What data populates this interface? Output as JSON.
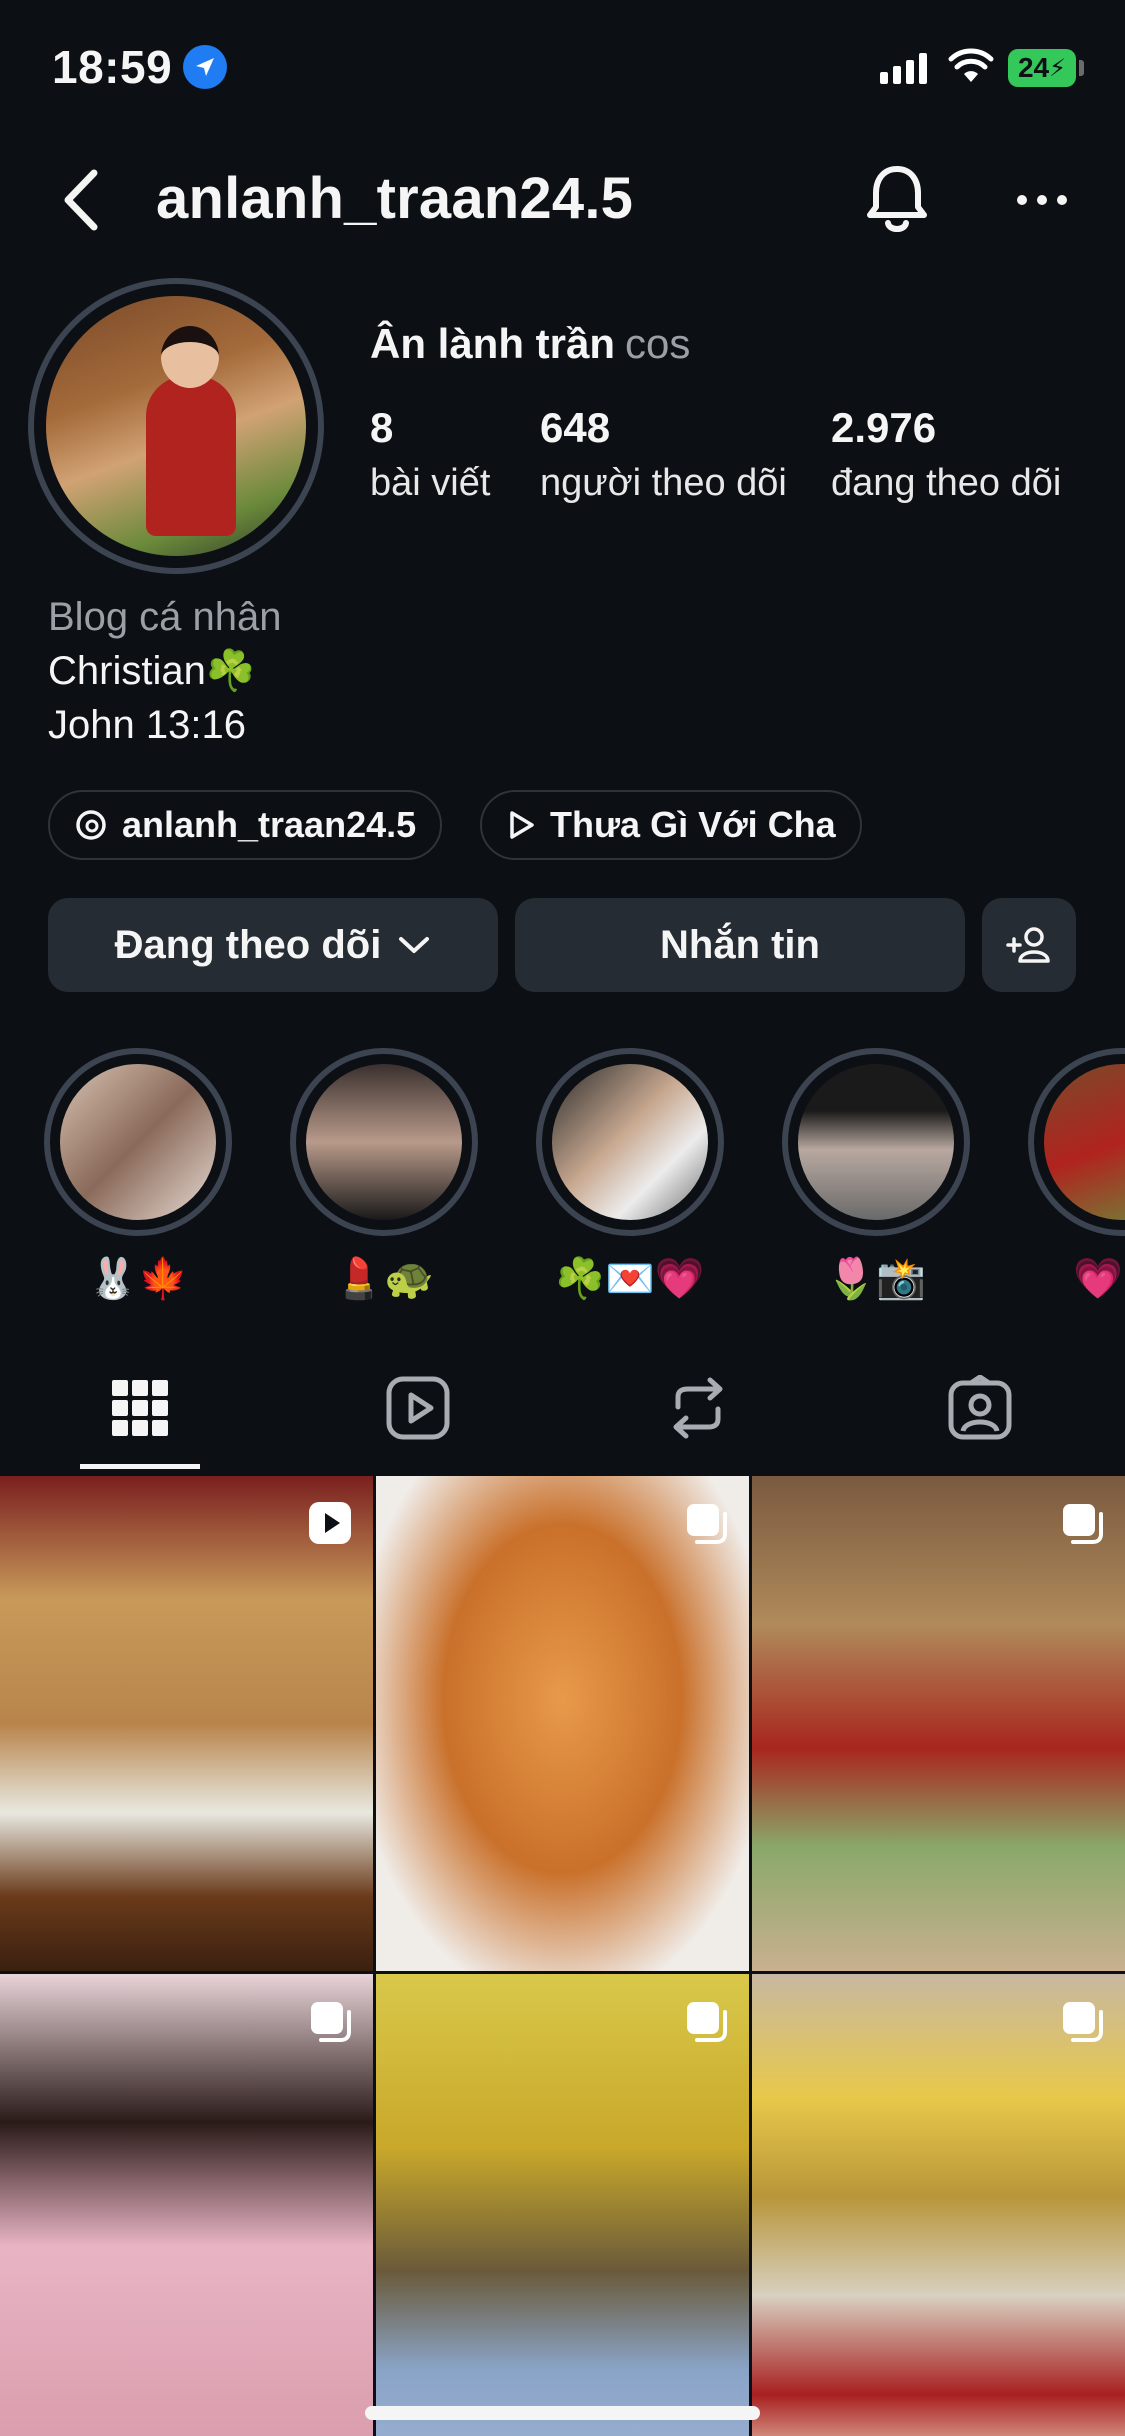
{
  "status_bar": {
    "time": "18:59",
    "battery": "24"
  },
  "header": {
    "username": "anlanh_traan24.5"
  },
  "profile": {
    "display_name": "Ân lành trần",
    "pronouns": "cos",
    "stats": [
      {
        "value": "8",
        "label": "bài viết"
      },
      {
        "value": "648",
        "label": "người theo dõi"
      },
      {
        "value": "2.976",
        "label": "đang theo dõi"
      }
    ],
    "bio": {
      "category": "Blog cá nhân",
      "lines": [
        "Christian☘️",
        "John 13:16"
      ]
    },
    "links": [
      {
        "icon": "threads-icon",
        "text": "anlanh_traan24.5"
      },
      {
        "icon": "play-icon",
        "text": "Thưa Gì Với Cha"
      }
    ]
  },
  "actions": {
    "following": "Đang theo dõi",
    "message": "Nhắn tin"
  },
  "highlights": [
    {
      "label": "🐰🍁",
      "color": "#c9b4a4"
    },
    {
      "label": "💄🐢",
      "color": "#6a5a55"
    },
    {
      "label": "☘️💌💗",
      "color": "#8a8a8a"
    },
    {
      "label": "🌷📸",
      "color": "#3a3a3a"
    },
    {
      "label": "💗",
      "color": "#9a3a2a"
    }
  ],
  "tabs": [
    "grid-icon",
    "reels-icon",
    "reposts-icon",
    "tagged-icon"
  ],
  "posts": [
    {
      "type": "reel",
      "color": "#8a5a34"
    },
    {
      "type": "carousel",
      "color": "#c98a4a"
    },
    {
      "type": "carousel",
      "color": "#9a6a40"
    },
    {
      "type": "carousel",
      "color": "#d7a8b8"
    },
    {
      "type": "carousel",
      "color": "#c9a838"
    },
    {
      "type": "carousel",
      "color": "#b8963a"
    }
  ]
}
